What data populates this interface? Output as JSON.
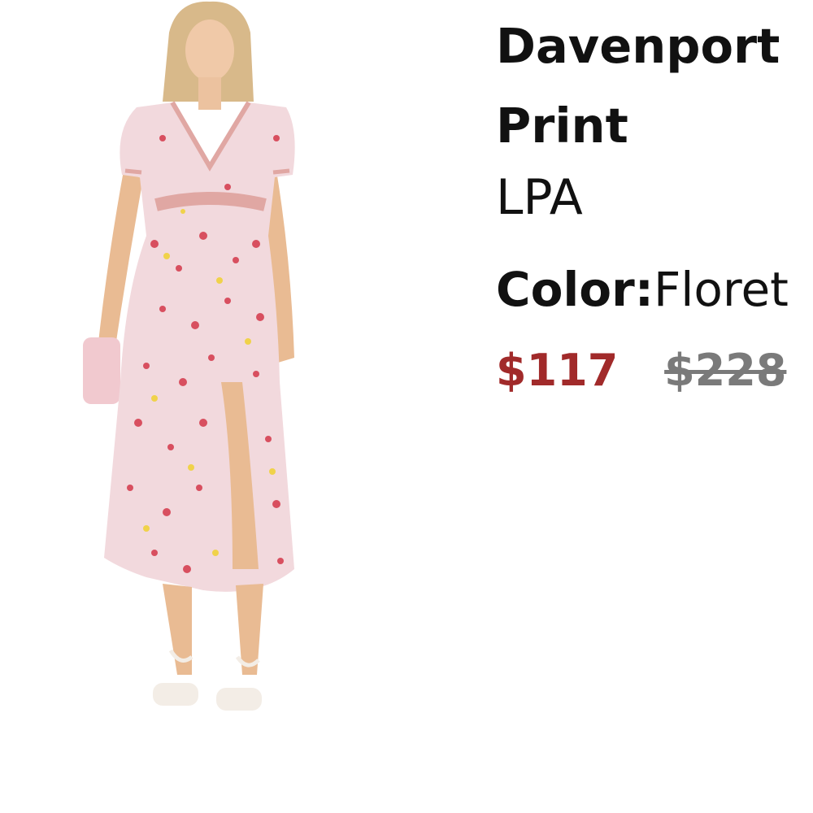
{
  "product": {
    "image_alt": "Model wearing a pink floral print midi dress",
    "title_line1": "Davenport",
    "title_line2": "Print",
    "brand": "LPA",
    "color_label": "Color:",
    "color_value": "Floret",
    "sale_price": "$117",
    "original_price": "$228"
  },
  "colors": {
    "sale_price": "#a12a2a",
    "original_price": "#7a7a7a",
    "dress_base": "#f2d9dd",
    "text": "#111111"
  }
}
